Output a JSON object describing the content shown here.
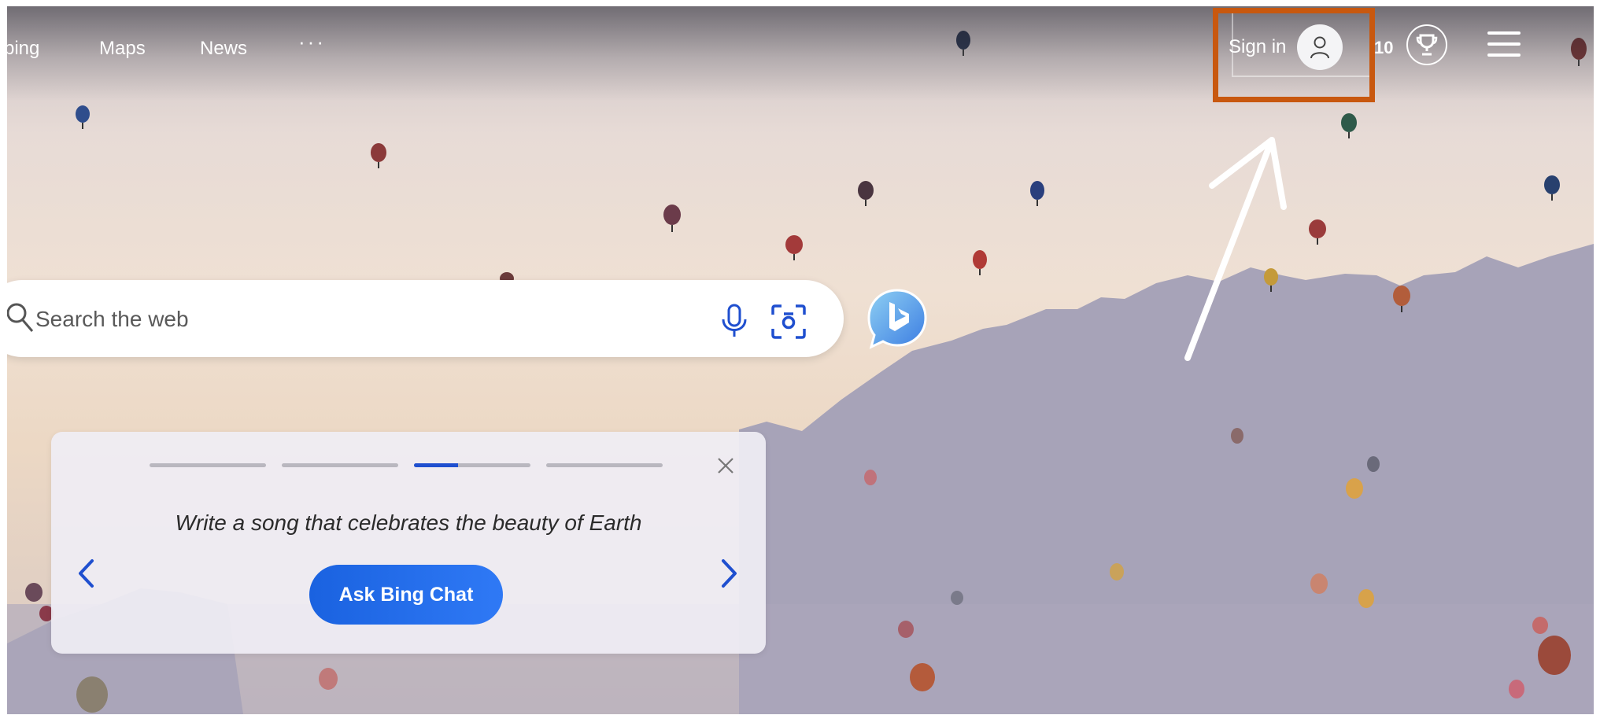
{
  "nav": {
    "links": [
      "ping",
      "Maps",
      "News"
    ],
    "more": "···"
  },
  "account": {
    "sign_in_label": "Sign in",
    "avatar_icon": "person-icon",
    "rewards_count": "10",
    "rewards_icon": "trophy-icon",
    "menu_icon": "hamburger-icon"
  },
  "search": {
    "placeholder": "Search the web",
    "icons": [
      "search-icon",
      "microphone-icon",
      "visual-search-icon",
      "bing-chat-icon"
    ]
  },
  "prompt_card": {
    "steps_total": 4,
    "active_step": 3,
    "active_step_progress": 0.38,
    "prompt": "Write a song that celebrates the beauty of Earth",
    "button_label": "Ask Bing Chat"
  },
  "annotation": {
    "highlight_color": "#c8580f",
    "arrow_color": "#ffffff",
    "target": "sign-in-button"
  },
  "colors": {
    "accent": "#1f4fcf",
    "button": "#2f79f5"
  }
}
